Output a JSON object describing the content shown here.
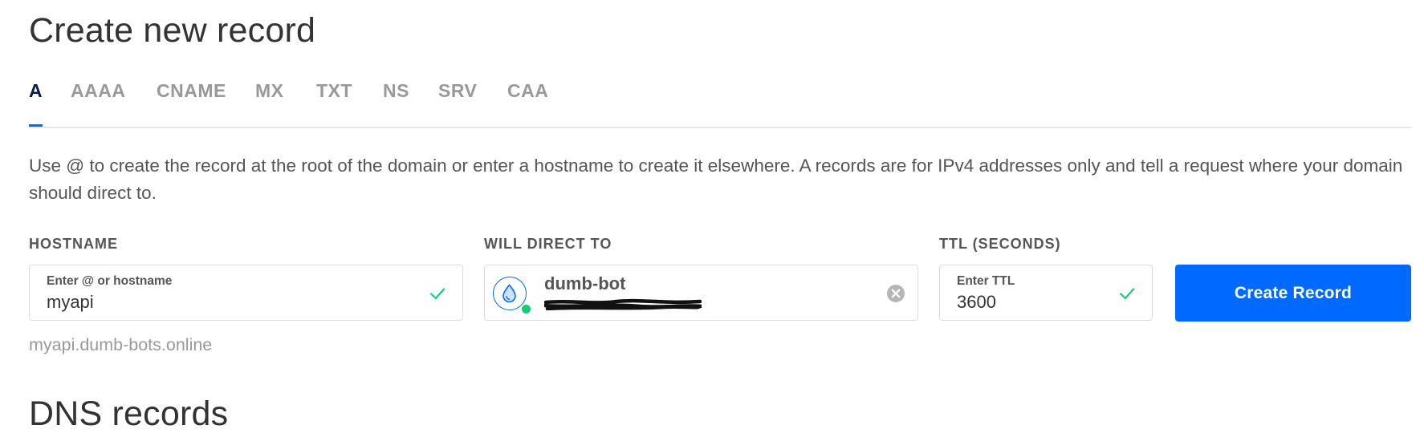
{
  "page_title": "Create new record",
  "tabs": [
    {
      "label": "A",
      "active": true
    },
    {
      "label": "AAAA",
      "active": false
    },
    {
      "label": "CNAME",
      "active": false
    },
    {
      "label": "MX",
      "active": false
    },
    {
      "label": "TXT",
      "active": false
    },
    {
      "label": "NS",
      "active": false
    },
    {
      "label": "SRV",
      "active": false
    },
    {
      "label": "CAA",
      "active": false
    }
  ],
  "description": "Use @ to create the record at the root of the domain or enter a hostname to create it elsewhere. A records are for IPv4 addresses only and tell a request where your domain should direct to.",
  "hostname": {
    "label": "HOSTNAME",
    "placeholder": "Enter @ or hostname",
    "value": "myapi",
    "valid": true
  },
  "direct_to": {
    "label": "WILL DIRECT TO",
    "droplet_name": "dumb-bot",
    "status": "active",
    "icon": "droplet-icon"
  },
  "ttl": {
    "label": "TTL (SECONDS)",
    "placeholder": "Enter TTL",
    "value": "3600",
    "valid": true
  },
  "create_button_label": "Create Record",
  "hostname_preview": "myapi.dumb-bots.online",
  "dns_section_title": "DNS records",
  "colors": {
    "primary": "#0069ff",
    "success": "#15cd72",
    "active_tab": "#031b4e",
    "muted": "#999999"
  }
}
